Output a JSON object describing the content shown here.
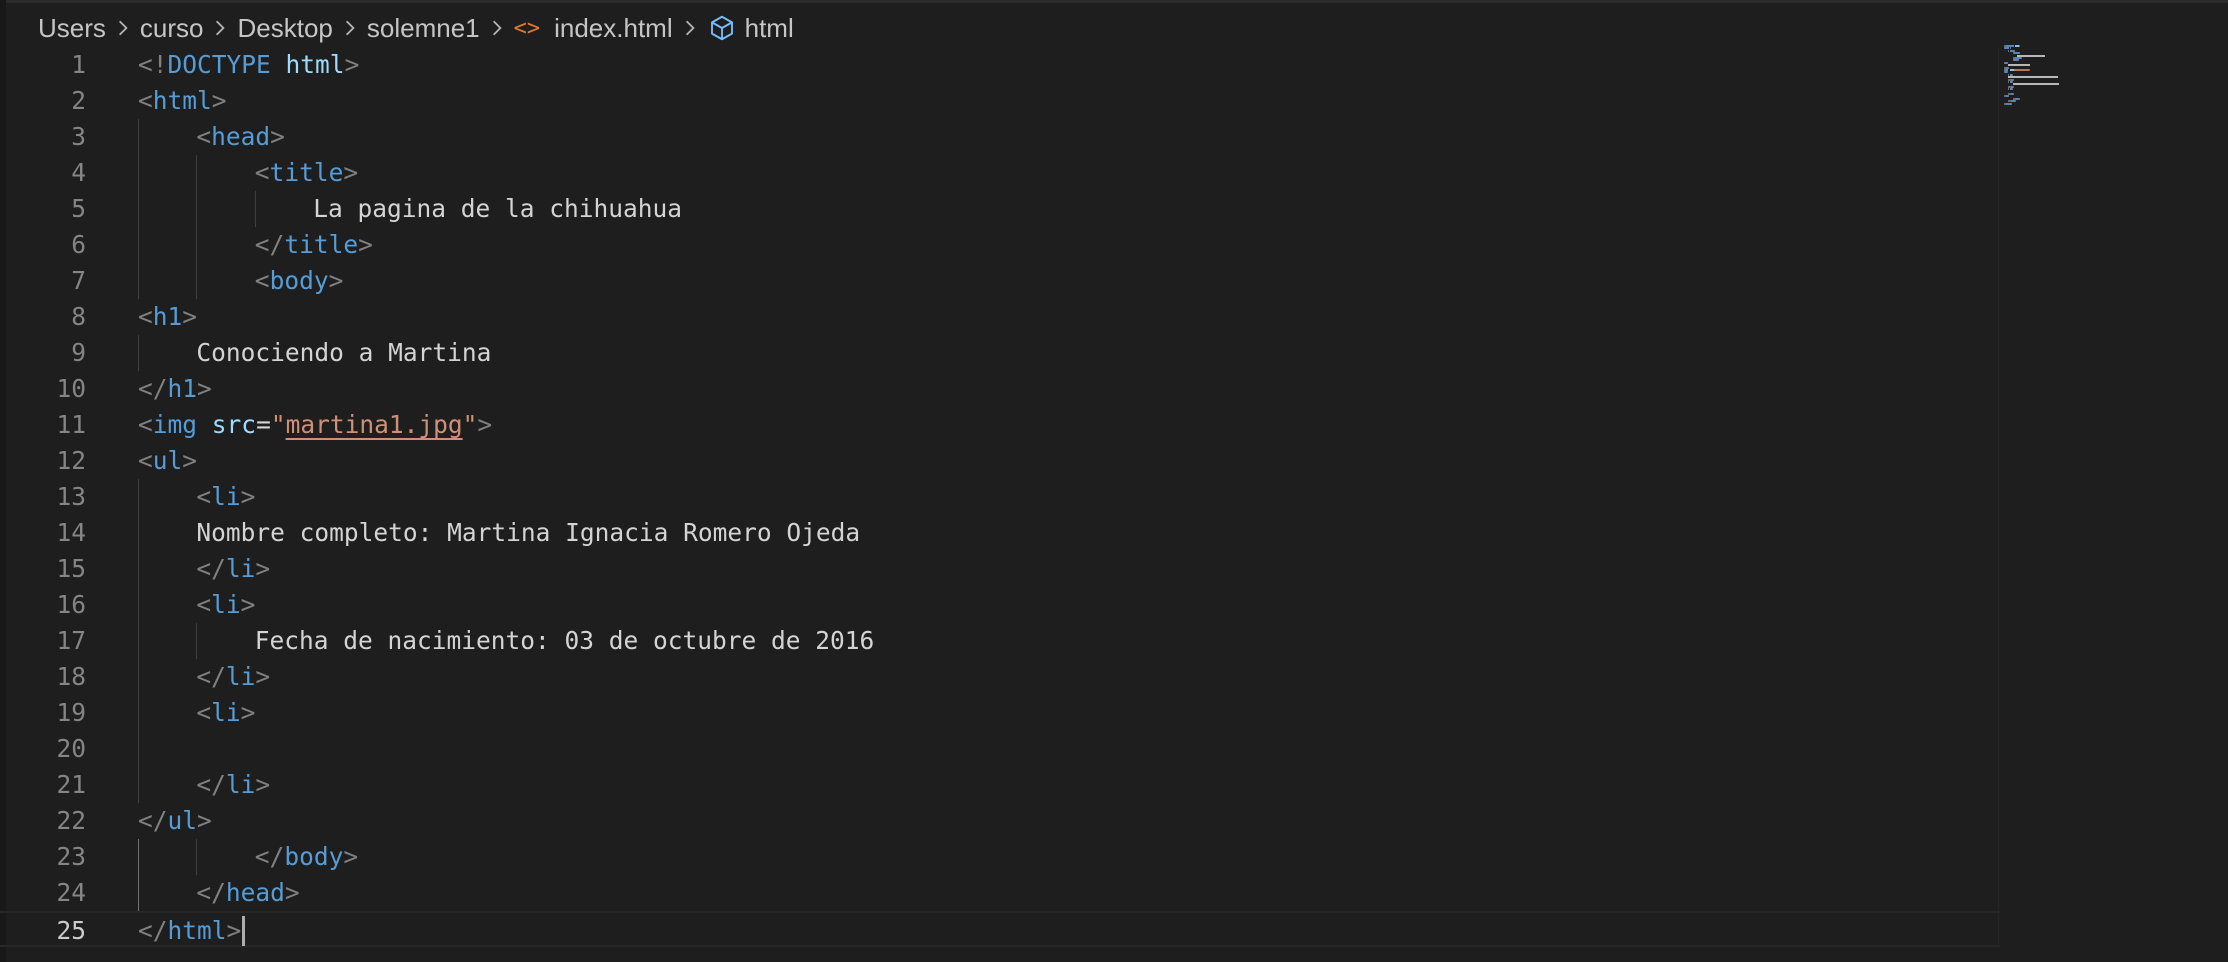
{
  "breadcrumb": {
    "items": [
      "Users",
      "curso",
      "Desktop",
      "solemne1",
      "index.html",
      "html"
    ]
  },
  "editor": {
    "current_line": 25,
    "lines": [
      {
        "num": "1",
        "tokens": [
          [
            "punc",
            "<!"
          ],
          [
            "doct",
            "DOCTYPE"
          ],
          [
            "txt",
            " "
          ],
          [
            "attr",
            "html"
          ],
          [
            "punc",
            ">"
          ]
        ]
      },
      {
        "num": "2",
        "tokens": [
          [
            "punc",
            "<"
          ],
          [
            "tag",
            "html"
          ],
          [
            "punc",
            ">"
          ]
        ]
      },
      {
        "num": "3",
        "tokens": [
          [
            "punc",
            "<"
          ],
          [
            "tag",
            "head"
          ],
          [
            "punc",
            ">"
          ]
        ]
      },
      {
        "num": "4",
        "tokens": [
          [
            "punc",
            "<"
          ],
          [
            "tag",
            "title"
          ],
          [
            "punc",
            ">"
          ]
        ]
      },
      {
        "num": "5",
        "tokens": [
          [
            "txt",
            "La pagina de la chihuahua"
          ]
        ]
      },
      {
        "num": "6",
        "tokens": [
          [
            "punc",
            "</"
          ],
          [
            "tag",
            "title"
          ],
          [
            "punc",
            ">"
          ]
        ]
      },
      {
        "num": "7",
        "tokens": [
          [
            "punc",
            "<"
          ],
          [
            "tag",
            "body"
          ],
          [
            "punc",
            ">"
          ]
        ]
      },
      {
        "num": "8",
        "tokens": [
          [
            "punc",
            "<"
          ],
          [
            "tag",
            "h1"
          ],
          [
            "punc",
            ">"
          ]
        ]
      },
      {
        "num": "9",
        "tokens": [
          [
            "txt",
            "Conociendo a Martina"
          ]
        ]
      },
      {
        "num": "10",
        "tokens": [
          [
            "punc",
            "</"
          ],
          [
            "tag",
            "h1"
          ],
          [
            "punc",
            ">"
          ]
        ]
      },
      {
        "num": "11",
        "tokens": [
          [
            "punc",
            "<"
          ],
          [
            "tag",
            "img"
          ],
          [
            "txt",
            " "
          ],
          [
            "attr",
            "src"
          ],
          [
            "txt",
            "="
          ],
          [
            "str",
            "\""
          ],
          [
            "strlink",
            "martina1.jpg"
          ],
          [
            "str",
            "\""
          ],
          [
            "punc",
            ">"
          ]
        ]
      },
      {
        "num": "12",
        "tokens": [
          [
            "punc",
            "<"
          ],
          [
            "tag",
            "ul"
          ],
          [
            "punc",
            ">"
          ]
        ]
      },
      {
        "num": "13",
        "tokens": [
          [
            "punc",
            "<"
          ],
          [
            "tag",
            "li"
          ],
          [
            "punc",
            ">"
          ]
        ]
      },
      {
        "num": "14",
        "tokens": [
          [
            "txt",
            "Nombre completo: Martina Ignacia Romero Ojeda"
          ]
        ]
      },
      {
        "num": "15",
        "tokens": [
          [
            "punc",
            "</"
          ],
          [
            "tag",
            "li"
          ],
          [
            "punc",
            ">"
          ]
        ]
      },
      {
        "num": "16",
        "tokens": [
          [
            "punc",
            "<"
          ],
          [
            "tag",
            "li"
          ],
          [
            "punc",
            ">"
          ]
        ]
      },
      {
        "num": "17",
        "tokens": [
          [
            "txt",
            "Fecha de nacimiento: 03 de octubre de 2016"
          ]
        ]
      },
      {
        "num": "18",
        "tokens": [
          [
            "punc",
            "</"
          ],
          [
            "tag",
            "li"
          ],
          [
            "punc",
            ">"
          ]
        ]
      },
      {
        "num": "19",
        "tokens": [
          [
            "punc",
            "<"
          ],
          [
            "tag",
            "li"
          ],
          [
            "punc",
            ">"
          ]
        ]
      },
      {
        "num": "20",
        "tokens": []
      },
      {
        "num": "21",
        "tokens": [
          [
            "punc",
            "</"
          ],
          [
            "tag",
            "li"
          ],
          [
            "punc",
            ">"
          ]
        ]
      },
      {
        "num": "22",
        "tokens": [
          [
            "punc",
            "</"
          ],
          [
            "tag",
            "ul"
          ],
          [
            "punc",
            ">"
          ]
        ]
      },
      {
        "num": "23",
        "tokens": [
          [
            "punc",
            "</"
          ],
          [
            "tag",
            "body"
          ],
          [
            "punc",
            ">"
          ]
        ]
      },
      {
        "num": "24",
        "tokens": [
          [
            "punc",
            "</"
          ],
          [
            "tag",
            "head"
          ],
          [
            "punc",
            ">"
          ]
        ]
      },
      {
        "num": "25",
        "tokens": [
          [
            "punc",
            "</"
          ],
          [
            "tag",
            "html"
          ],
          [
            "punc",
            ">"
          ]
        ]
      }
    ]
  },
  "colors": {
    "background": "#1e1e1e",
    "tag": "#569cd6",
    "attribute": "#9cdcfe",
    "string": "#ce9178",
    "text": "#d4d4d4",
    "punctuation": "#808080",
    "line_number": "#858585",
    "file_icon": "#e37933",
    "symbol_icon": "#75beff"
  },
  "icons": [
    "chevron-right-icon",
    "html-file-icon",
    "symbol-element-icon"
  ]
}
